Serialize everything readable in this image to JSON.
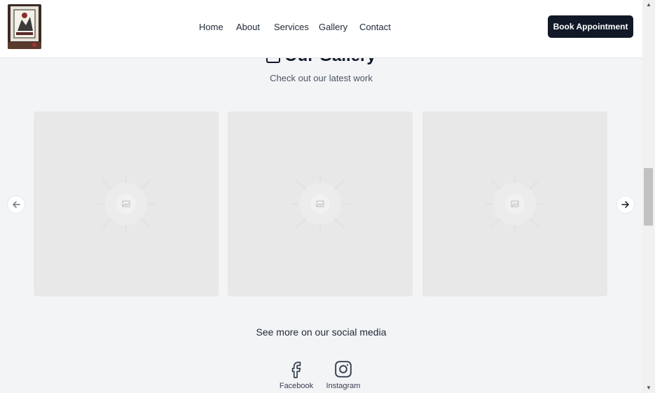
{
  "header": {
    "nav": [
      "Home",
      "About",
      "Services",
      "Gallery",
      "Contact"
    ],
    "cta_label": "Book Appointment"
  },
  "gallery": {
    "title": "Our Gallery",
    "subtitle": "Check out our latest work",
    "image_count": 3
  },
  "social": {
    "heading": "See more on our social media",
    "links": [
      {
        "label": "Facebook",
        "icon": "facebook-icon"
      },
      {
        "label": "Instagram",
        "icon": "instagram-icon"
      }
    ]
  },
  "colors": {
    "page_bg": "#f3f4f6",
    "header_bg": "#ffffff",
    "cta_bg": "#111827",
    "placeholder_bg": "#e8e8e8"
  }
}
